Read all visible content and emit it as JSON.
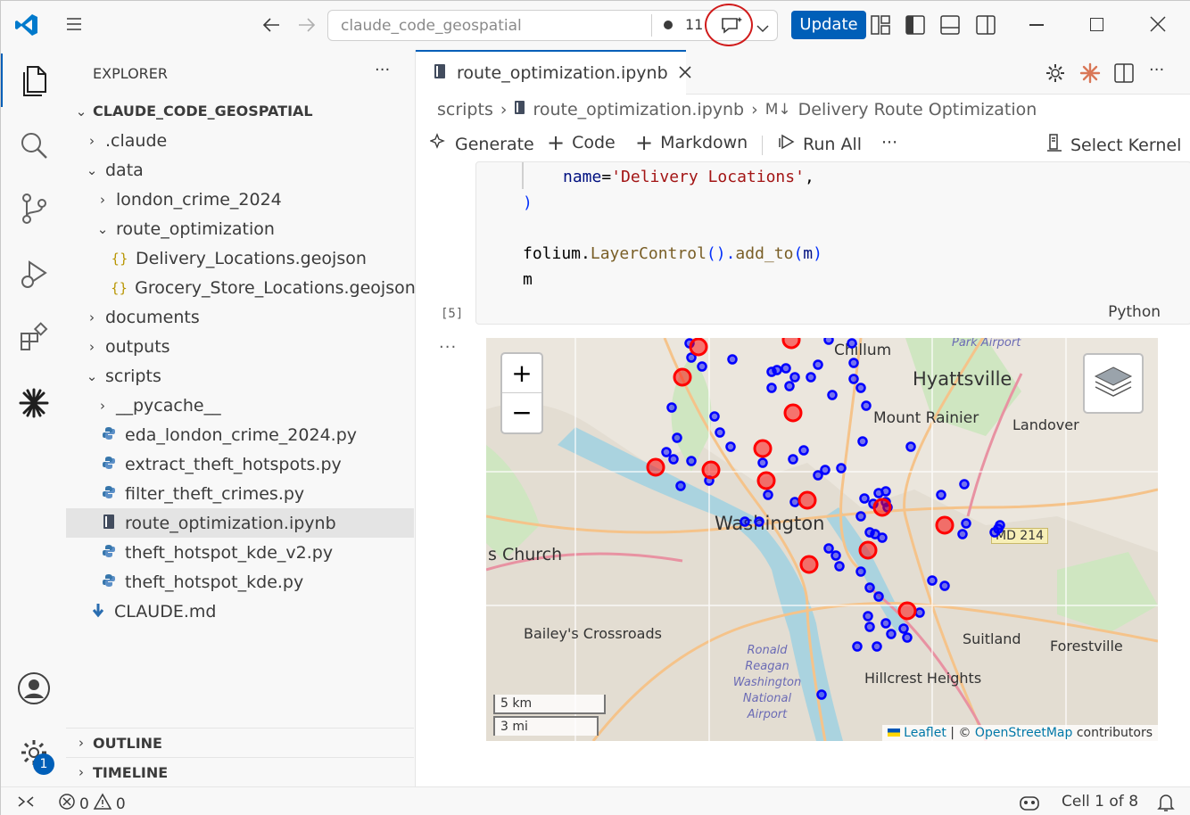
{
  "titlebar": {
    "search_text": "claude_code_geospatial",
    "changes_count": "11",
    "update_label": "Update"
  },
  "sidebar": {
    "title": "EXPLORER",
    "more": "···",
    "root": "CLAUDE_CODE_GEOSPATIAL",
    "items": [
      {
        "label": ".claude",
        "type": "folder",
        "expanded": false
      },
      {
        "label": "data",
        "type": "folder",
        "expanded": true
      },
      {
        "label": "london_crime_2024",
        "type": "folder",
        "expanded": false
      },
      {
        "label": "route_optimization",
        "type": "folder",
        "expanded": true
      },
      {
        "label": "Delivery_Locations.geojson",
        "type": "json"
      },
      {
        "label": "Grocery_Store_Locations.geojson",
        "type": "json"
      },
      {
        "label": "documents",
        "type": "folder",
        "expanded": false
      },
      {
        "label": "outputs",
        "type": "folder",
        "expanded": false
      },
      {
        "label": "scripts",
        "type": "folder",
        "expanded": true
      },
      {
        "label": "__pycache__",
        "type": "folder",
        "expanded": false
      },
      {
        "label": "eda_london_crime_2024.py",
        "type": "python"
      },
      {
        "label": "extract_theft_hotspots.py",
        "type": "python"
      },
      {
        "label": "filter_theft_crimes.py",
        "type": "python"
      },
      {
        "label": "route_optimization.ipynb",
        "type": "notebook",
        "selected": true
      },
      {
        "label": "theft_hotspot_kde_v2.py",
        "type": "python"
      },
      {
        "label": "theft_hotspot_kde.py",
        "type": "python"
      },
      {
        "label": "CLAUDE.md",
        "type": "markdown"
      }
    ],
    "outline": "OUTLINE",
    "timeline": "TIMELINE"
  },
  "activitybar": {
    "settings_badge": "1"
  },
  "editor": {
    "tab_label": "route_optimization.ipynb",
    "breadcrumb": [
      "scripts",
      "route_optimization.ipynb",
      "Delivery Route Optimization"
    ],
    "toolbar": {
      "generate": "Generate",
      "code": "Code",
      "markdown": "Markdown",
      "run_all": "Run All",
      "more": "···",
      "select_kernel": "Select Kernel"
    },
    "cell": {
      "line1_name": "name",
      "line1_eq": "=",
      "line1_str": "'Delivery Locations'",
      "line1_comma": ",",
      "line2": ")",
      "line4_a": "folium.",
      "line4_fn": "LayerControl",
      "line4_b": "().",
      "line4_fn2": "add_to",
      "line4_c": "(",
      "line4_m": "m",
      "line4_d": ")",
      "line5": "m",
      "language": "Python",
      "exec_count": "[5]"
    },
    "output_more": "···"
  },
  "map": {
    "zoom_in": "+",
    "zoom_out": "−",
    "scale_km": "5 km",
    "scale_mi": "3 mi",
    "attribution_leaflet": "Leaflet",
    "attribution_sep": " | © ",
    "attribution_osm": "OpenStreetMap",
    "attribution_tail": " contributors",
    "places": [
      {
        "name": "Chillum"
      },
      {
        "name": "Hyattsville"
      },
      {
        "name": "Mount Rainier"
      },
      {
        "name": "Landover"
      },
      {
        "name": "Washington"
      },
      {
        "name": "s Church"
      },
      {
        "name": "Bailey's Crossroads"
      },
      {
        "name": "Suitland"
      },
      {
        "name": "Forestville"
      },
      {
        "name": "Hillcrest Heights"
      },
      {
        "name": "MD 214"
      },
      {
        "name": "Park Airport"
      },
      {
        "name": "Ronald Reagan Washington National Airport"
      }
    ],
    "colors": {
      "grocery": "#ff0000",
      "delivery": "#0000ff"
    }
  },
  "statusbar": {
    "errors": "0",
    "warnings": "0",
    "cell_info": "Cell 1 of 8"
  }
}
